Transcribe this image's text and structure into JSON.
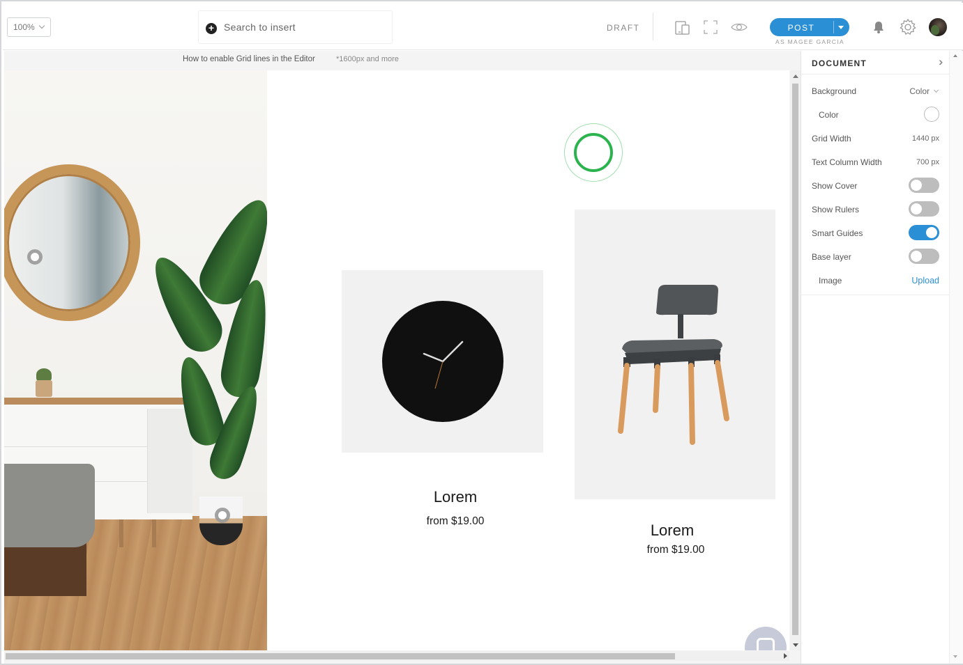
{
  "toolbar": {
    "zoom": "100%",
    "search_placeholder": "Search to insert",
    "status": "DRAFT",
    "post_label": "POST",
    "post_as": "AS MAGEE GARCIA"
  },
  "canvas": {
    "hint": "How to enable Grid lines in the Editor",
    "hint_note": "*1600px and more"
  },
  "products": [
    {
      "title": "Lorem",
      "price": "from $19.00"
    },
    {
      "title": "Lorem",
      "price": "from $19.00"
    }
  ],
  "panel": {
    "title": "DOCUMENT",
    "rows": {
      "background": {
        "label": "Background",
        "value": "Color"
      },
      "color": {
        "label": "Color",
        "value": "#ffffff"
      },
      "grid_width": {
        "label": "Grid Width",
        "value": "1440 px"
      },
      "text_column_width": {
        "label": "Text Column Width",
        "value": "700 px"
      },
      "show_cover": {
        "label": "Show Cover",
        "on": false
      },
      "show_rulers": {
        "label": "Show Rulers",
        "on": false
      },
      "smart_guides": {
        "label": "Smart Guides",
        "on": true
      },
      "base_layer": {
        "label": "Base layer",
        "on": false
      },
      "image": {
        "label": "Image",
        "action": "Upload"
      }
    }
  },
  "colors": {
    "accent": "#2b8fd6",
    "spinner": "#2bb34e",
    "toggle_off": "#bdbdbd"
  },
  "icons": {
    "zoom": "chevron-down-icon",
    "search": "plus-circle-icon",
    "responsive": "devices-icon",
    "fullscreen": "fullscreen-icon",
    "preview": "eye-icon",
    "post_menu": "caret-down-icon",
    "notifications": "bell-icon",
    "settings": "gear-icon",
    "panel_collapse": "double-chevron-right-icon",
    "chat": "chat-bubble-icon"
  }
}
